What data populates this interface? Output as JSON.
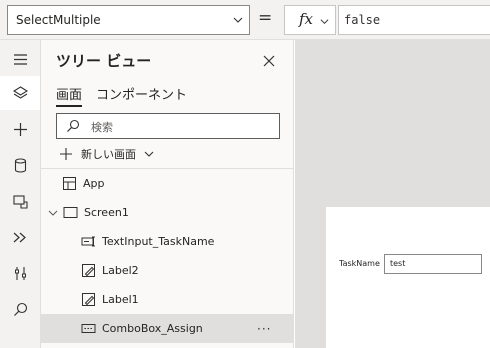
{
  "formula_bar": {
    "property": "SelectMultiple",
    "equals": "=",
    "fx_label": "fx",
    "formula": "false"
  },
  "rail": {
    "items": [
      {
        "icon": "hamburger-menu-icon"
      },
      {
        "icon": "layers-icon",
        "active": true
      },
      {
        "icon": "plus-icon"
      },
      {
        "icon": "database-icon"
      },
      {
        "icon": "media-icon"
      },
      {
        "icon": "power-automate-icon"
      },
      {
        "icon": "advanced-tools-icon"
      },
      {
        "icon": "search-icon"
      }
    ]
  },
  "tree": {
    "title": "ツリー ビュー",
    "tabs": [
      "画面",
      "コンポーネント"
    ],
    "search_placeholder": "検索",
    "new_screen": "新しい画面",
    "nodes": [
      {
        "label": "App",
        "icon": "app-icon"
      },
      {
        "label": "Screen1",
        "icon": "screen-icon"
      },
      {
        "label": "TextInput_TaskName",
        "icon": "text-input-icon"
      },
      {
        "label": "Label2",
        "icon": "label-icon"
      },
      {
        "label": "Label1",
        "icon": "label-icon"
      },
      {
        "label": "ComboBox_Assign",
        "icon": "combobox-icon",
        "selected": true
      }
    ],
    "more": "···"
  },
  "canvas": {
    "field_label": "TaskName",
    "field_value": "test"
  },
  "colors": {
    "chrome": "#f3f2f1",
    "panel": "#faf9f8",
    "selected": "#e1dfdd",
    "canvas_bg": "#e1dfdd"
  }
}
